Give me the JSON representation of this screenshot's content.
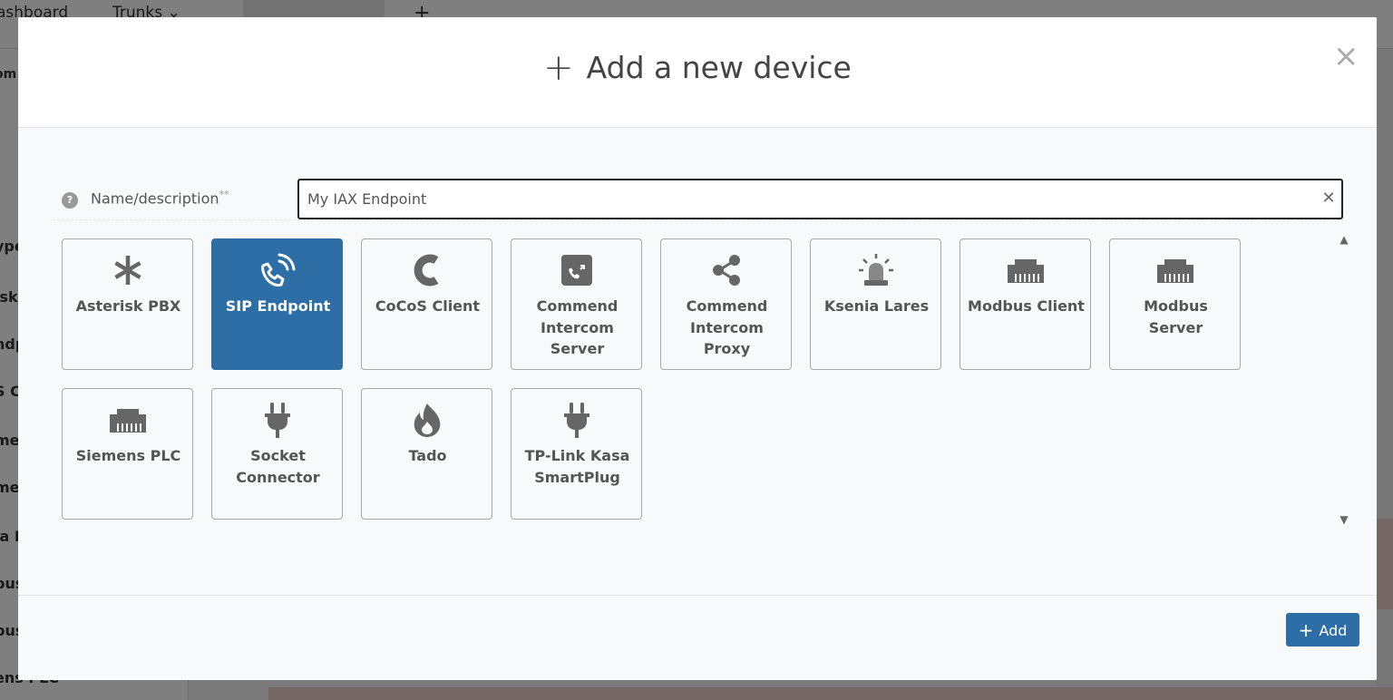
{
  "background": {
    "tabs": [
      "ashboard",
      "Trunks",
      "+"
    ],
    "sidebar_items": [
      "ype",
      "isk",
      "ndp",
      "S C",
      "me",
      "me",
      "ia L",
      "bus",
      "bus",
      "ens PLC"
    ],
    "top_left_fragment": "om"
  },
  "modal": {
    "title": "Add a new device",
    "close_label": "×",
    "field": {
      "label": "Name/description",
      "required_marker": "**",
      "help": "?",
      "value": "My IAX Endpoint",
      "clear_label": "✕"
    },
    "devices": [
      {
        "label": "Asterisk PBX",
        "icon": "asterisk-icon",
        "selected": false
      },
      {
        "label": "SIP Endpoint",
        "icon": "phone-icon",
        "selected": true
      },
      {
        "label": "CoCoS Client",
        "icon": "cocos-logo-icon",
        "selected": false
      },
      {
        "label": "Commend Intercom Server",
        "icon": "phone-square-icon",
        "selected": false
      },
      {
        "label": "Commend Intercom Proxy",
        "icon": "share-icon",
        "selected": false
      },
      {
        "label": "Ksenia Lares",
        "icon": "alarm-siren-icon",
        "selected": false
      },
      {
        "label": "Modbus Client",
        "icon": "ethernet-icon",
        "selected": false
      },
      {
        "label": "Modbus Server",
        "icon": "ethernet-icon",
        "selected": false
      },
      {
        "label": "Siemens PLC",
        "icon": "ethernet-icon",
        "selected": false
      },
      {
        "label": "Socket Connector",
        "icon": "plug-icon",
        "selected": false
      },
      {
        "label": "Tado",
        "icon": "fire-icon",
        "selected": false
      },
      {
        "label": "TP-Link Kasa SmartPlug",
        "icon": "plug-icon",
        "selected": false
      }
    ],
    "footer": {
      "add_label": "Add"
    }
  },
  "colors": {
    "accent": "#2e6ea6",
    "icon_gray": "#666666"
  }
}
